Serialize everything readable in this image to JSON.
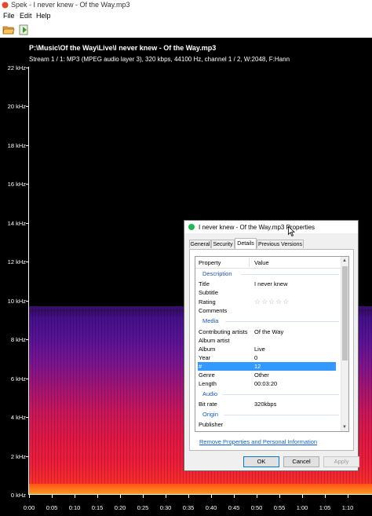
{
  "window": {
    "title": "Spek - I never knew - Of the Way.mp3"
  },
  "menu": {
    "file": "File",
    "edit": "Edit",
    "help": "Help"
  },
  "toolbar": {
    "open_icon": "folder-open-icon",
    "save_icon": "save-export-icon"
  },
  "spek": {
    "file_path": "P:\\Music\\Of the Way\\Live\\I never knew - Of the Way.mp3",
    "stream_info": "Stream 1 / 1: MP3 (MPEG audio layer 3), 320 kbps, 44100 Hz, channel 1 / 2, W:2048, F:Hann",
    "y_axis": [
      "22 kHz",
      "20 kHz",
      "18 kHz",
      "16 kHz",
      "14 kHz",
      "12 kHz",
      "10 kHz",
      "8 kHz",
      "6 kHz",
      "4 kHz",
      "2 kHz",
      "0 kHz"
    ],
    "x_axis": [
      "0:00",
      "0:05",
      "0:10",
      "0:15",
      "0:20",
      "0:25",
      "0:30",
      "0:35",
      "0:40",
      "0:45",
      "0:50",
      "0:55",
      "1:00",
      "1:05",
      "1:10"
    ],
    "colors": {
      "background": "#000000",
      "low": "#ff3a20",
      "mid": "#c8175a",
      "high": "#44108a"
    }
  },
  "dialog": {
    "title": "I never knew - Of the Way.mp3 Properties",
    "tabs": [
      "General",
      "Security",
      "Details",
      "Previous Versions"
    ],
    "active_tab": "Details",
    "columns": {
      "property": "Property",
      "value": "Value"
    },
    "sections": {
      "description": "Description",
      "media": "Media",
      "audio": "Audio",
      "origin": "Origin"
    },
    "rows": {
      "title": {
        "k": "Title",
        "v": "I never knew"
      },
      "subtitle": {
        "k": "Subtitle",
        "v": ""
      },
      "rating": {
        "k": "Rating",
        "v": "☆☆☆☆☆"
      },
      "comments": {
        "k": "Comments",
        "v": ""
      },
      "contributing_artists": {
        "k": "Contributing artists",
        "v": "Of the Way"
      },
      "album_artist": {
        "k": "Album artist",
        "v": ""
      },
      "album": {
        "k": "Album",
        "v": "Live"
      },
      "year": {
        "k": "Year",
        "v": "0"
      },
      "number": {
        "k": "#",
        "v": "12"
      },
      "genre": {
        "k": "Genre",
        "v": "Other"
      },
      "length": {
        "k": "Length",
        "v": "00:03:20"
      },
      "bit_rate": {
        "k": "Bit rate",
        "v": "320kbps"
      },
      "publisher": {
        "k": "Publisher",
        "v": ""
      }
    },
    "link": "Remove Properties and Personal Information",
    "buttons": {
      "ok": "OK",
      "cancel": "Cancel",
      "apply": "Apply"
    }
  }
}
